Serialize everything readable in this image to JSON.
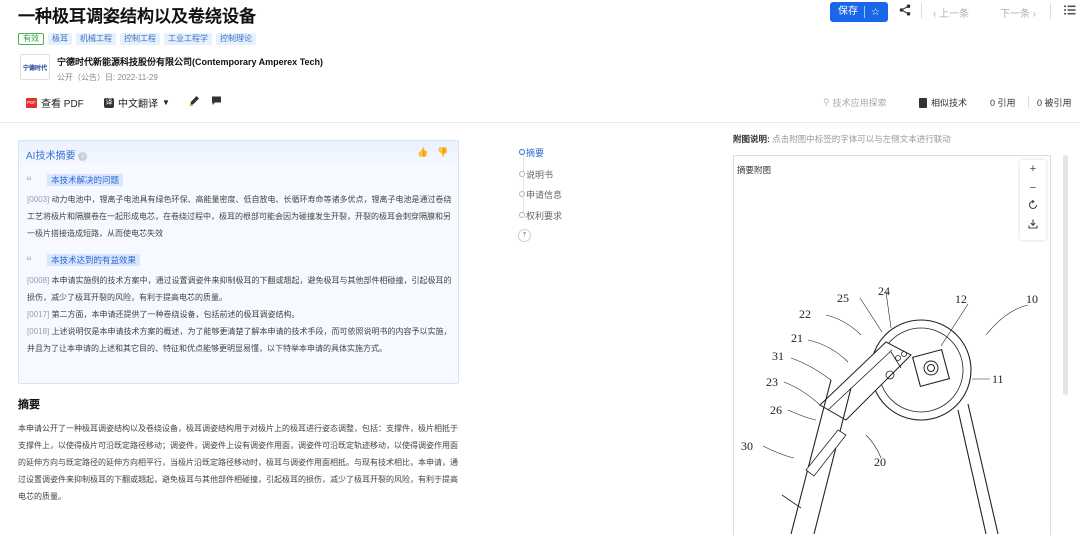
{
  "header": {
    "title": "一种极耳调姿结构以及卷绕设备",
    "save_label": "保存",
    "prev_label": "上一条",
    "next_label": "下一条"
  },
  "tags": {
    "status": "有效",
    "items": [
      "极耳",
      "机械工程",
      "控制工程",
      "工业工程学",
      "控制理论"
    ]
  },
  "applicant": {
    "logo_text": "宁德时代",
    "name": "宁德时代新能源科技股份有限公司(Contemporary Amperex Tech)",
    "pub_date": "公开（公告）日: 2022-11-29"
  },
  "toolbar": {
    "view_pdf": "查看 PDF",
    "translate": "中文翻译",
    "pdf_badge": "PDF"
  },
  "right_tools": {
    "tech_graph": "技术应用探索",
    "similar": "相似技术",
    "cited": "0 引用",
    "cited_by": "0 被引用"
  },
  "ai_summary": {
    "title": "AI技术摘要",
    "problem_label": "本技术解决的问题",
    "problem_ref": "[0003]",
    "problem_text": "动力电池中，锂离子电池具有绿色环保、高能量密度、低自放电、长循环寿命等诸多优点，锂离子电池是通过卷绕工艺将极片和隔膜卷在一起形成电芯，在卷绕过程中，极耳的根部可能会因为碰撞发生开裂，开裂的极耳会刺穿隔膜和另一极片搭接造成短路，从而使电芯失效",
    "effect_label": "本技术达到的有益效果",
    "effects": [
      {
        "ref": "[0008]",
        "text": "本申请实施例的技术方案中，通过设置调姿件来抑制极耳的下翻或翘起，避免极耳与其他部件相碰撞，引起极耳的损伤，减少了极耳开裂的风险，有利于提高电芯的质量。"
      },
      {
        "ref": "[0017]",
        "text": "第二方面，本申请还提供了一种卷绕设备，包括前述的极耳调姿结构。"
      },
      {
        "ref": "[0018]",
        "text": "上述说明仅是本申请技术方案的概述，为了能够更清楚了解本申请的技术手段，而可依照说明书的内容予以实施，并且为了让本申请的上述和其它目的、特征和优点能够更明显易懂，以下特举本申请的具体实施方式。"
      }
    ]
  },
  "abstract": {
    "title": "摘要",
    "text": "本申请公开了一种极耳调姿结构以及卷绕设备，极耳调姿结构用于对极片上的极耳进行姿态调整，包括：支撑件，极片相抵于支撑件上，以使得极片可沿既定路径移动；调姿件，调姿件上设有调姿作用面，调姿件可沿既定轨迹移动，以使得调姿作用面的延伸方向与既定路径的延伸方向相平行，当极片沿既定路径移动时，极耳与调姿作用面相抵。与现有技术相比，本申请，通过设置调姿件来抑制极耳的下翻或翘起，避免极耳与其他部件相碰撞，引起极耳的损伤，减少了极耳开裂的风险，有利于提高电芯的质量。"
  },
  "section_nav": [
    "摘要",
    "说明书",
    "申请信息",
    "权利要求"
  ],
  "figure": {
    "caption_bold": "附图说明:",
    "caption": "点击附图中标签的字体可以与左侧文本进行联动",
    "label": "摘要附图",
    "zoom_in": "+",
    "zoom_out": "−",
    "numbers": [
      "25",
      "24",
      "12",
      "10",
      "22",
      "21",
      "31",
      "11",
      "23",
      "26",
      "20",
      "30"
    ]
  },
  "colors": {
    "accent": "#1a66e8",
    "ai_border": "#d5e3f7",
    "tag_bg": "#e6f1fb",
    "status_green": "#2e9d4a"
  }
}
